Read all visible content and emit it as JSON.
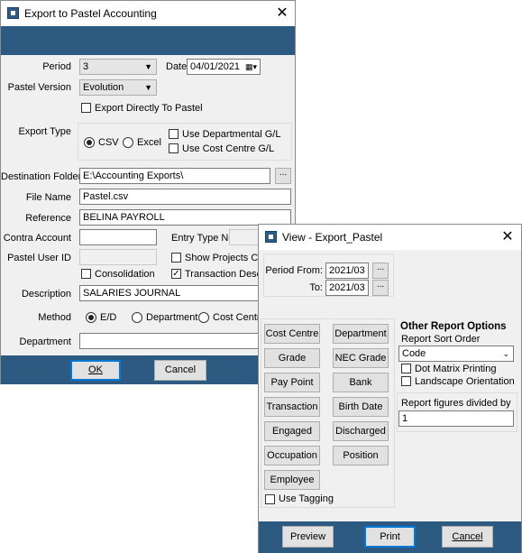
{
  "export_dialog": {
    "title": "Export to Pastel Accounting",
    "period_label": "Period",
    "period_value": "3",
    "date_label": "Date",
    "date_value": "04/01/2021",
    "pastel_version_label": "Pastel Version",
    "pastel_version_value": "Evolution",
    "export_directly_label": "Export Directly To Pastel",
    "export_type_label": "Export Type",
    "csv_label": "CSV",
    "excel_label": "Excel",
    "use_departmental_label": "Use Departmental G/L",
    "use_cost_centre_label": "Use Cost Centre G/L",
    "destination_folder_label": "Destination Folder",
    "destination_folder_value": "E:\\Accounting Exports\\",
    "browse_label": "...",
    "file_name_label": "File Name",
    "file_name_value": "Pastel.csv",
    "reference_label": "Reference",
    "reference_value": "BELINA PAYROLL",
    "contra_account_label": "Contra Account",
    "contra_account_value": "",
    "entry_type_label": "Entry Type No",
    "entry_type_value": "",
    "pastel_user_id_label": "Pastel User ID",
    "pastel_user_id_value": "",
    "show_projects_label": "Show Projects Code",
    "consolidation_label": "Consolidation",
    "transaction_desc_label": "Transaction Description",
    "description_label": "Description",
    "description_value": "SALARIES JOURNAL",
    "method_label": "Method",
    "method_ed_label": "E/D",
    "method_department_label": "Department",
    "method_cost_centre_label": "Cost Centre",
    "department_label": "Department",
    "department_value": "",
    "ok_label": "OK",
    "cancel_label": "Cancel",
    "close_glyph": "✕"
  },
  "view_dialog": {
    "title": "View - Export_Pastel",
    "period_from_label": "Period From:",
    "period_from_value": "2021/03",
    "to_label": "To:",
    "to_value": "2021/03",
    "browse_label": "...",
    "filter_buttons": [
      "Cost Centre",
      "Department",
      "Grade",
      "NEC Grade",
      "Pay Point",
      "Bank",
      "Transaction",
      "Birth Date",
      "Engaged",
      "Discharged",
      "Occupation",
      "Position",
      "Employee"
    ],
    "use_tagging_label": "Use Tagging",
    "other_options_title": "Other Report Options",
    "sort_order_label": "Report Sort Order",
    "sort_order_value": "Code",
    "dot_matrix_label": "Dot Matrix Printing",
    "landscape_label": "Landscape Orientation",
    "divided_by_label": "Report figures divided by",
    "divided_by_value": "1",
    "preview_label": "Preview",
    "print_label": "Print",
    "cancel_label": "Cancel",
    "close_glyph": "✕"
  }
}
